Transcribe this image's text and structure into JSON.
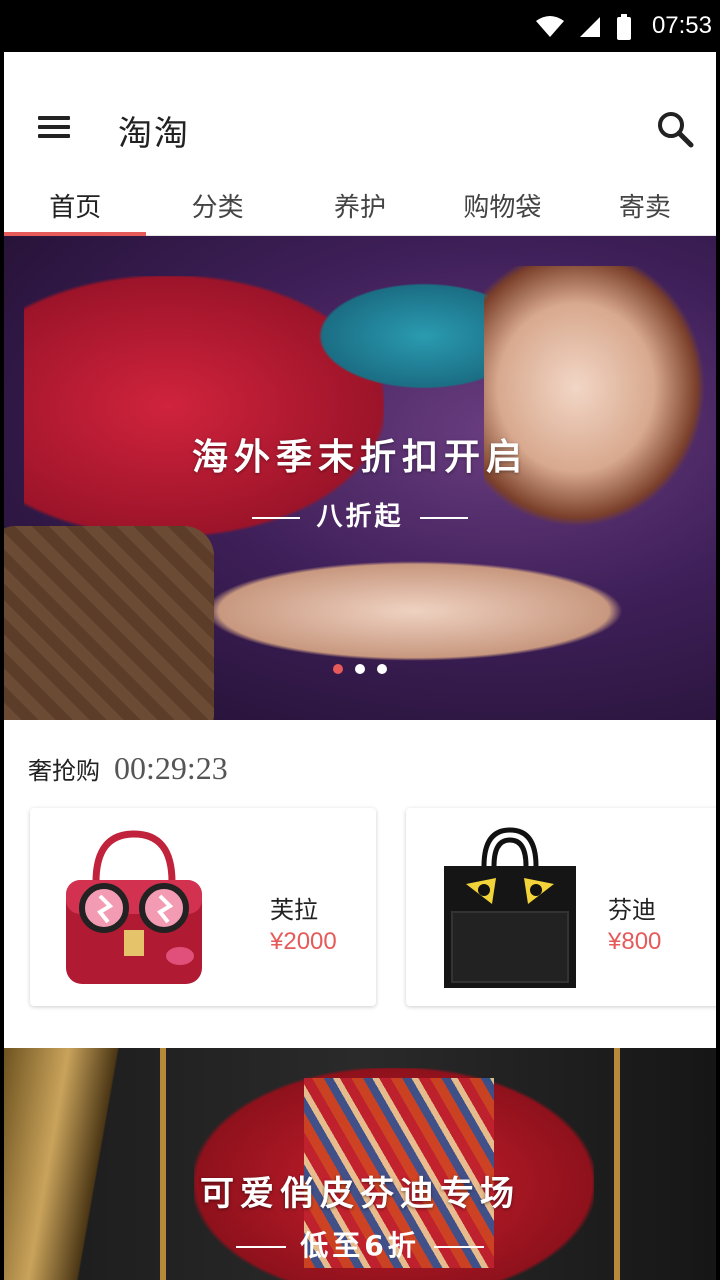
{
  "status_bar": {
    "time": "07:53"
  },
  "header": {
    "title": "淘淘"
  },
  "tabs": [
    {
      "label": "首页",
      "active": true
    },
    {
      "label": "分类",
      "active": false
    },
    {
      "label": "养护",
      "active": false
    },
    {
      "label": "购物袋",
      "active": false
    },
    {
      "label": "寄卖",
      "active": false
    }
  ],
  "hero": {
    "title": "海外季末折扣开启",
    "subtitle": "八折起",
    "page_count": 3,
    "active_page": 0
  },
  "flash_sale": {
    "label": "奢抢购",
    "timer": "00:29:23",
    "products": [
      {
        "name": "芙拉",
        "price": "¥2000"
      },
      {
        "name": "芬迪",
        "price": "¥800"
      }
    ]
  },
  "promo": {
    "title": "可爱俏皮芬迪专场",
    "subtitle": "低至6折"
  },
  "colors": {
    "accent": "#e65a5a",
    "text": "#222222"
  }
}
